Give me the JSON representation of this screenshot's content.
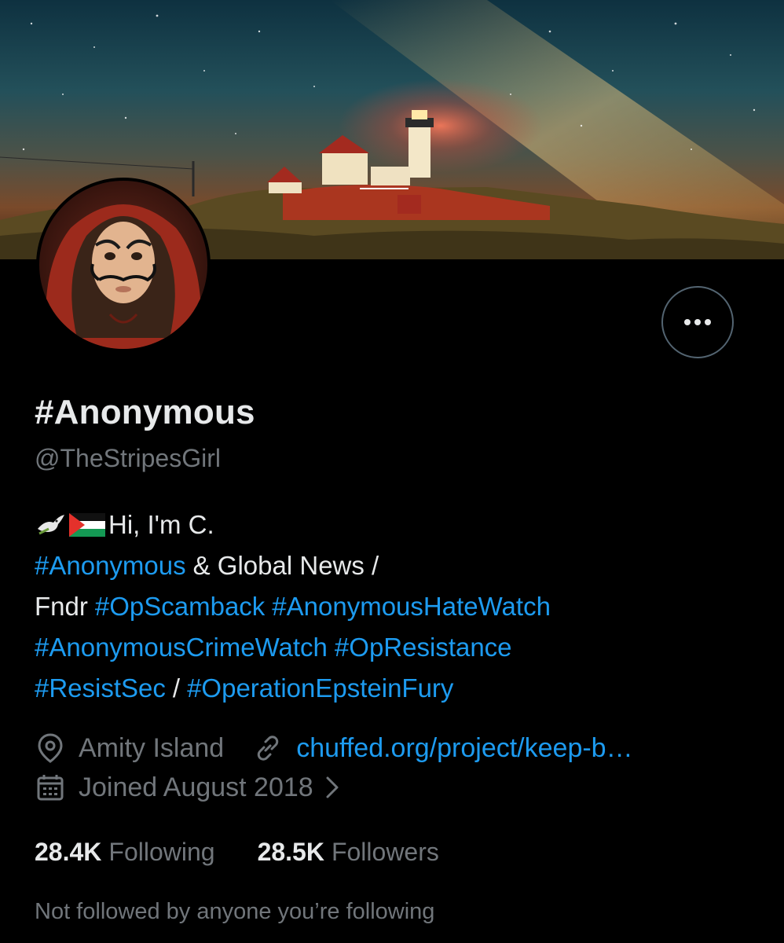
{
  "profile": {
    "display_name": "#Anonymous",
    "handle": "@TheStripesGirl",
    "more_button_icon": "more-horizontal-icon"
  },
  "bio": {
    "line1_text": "Hi, I'm C.",
    "line1_emojis": [
      "dove-emoji",
      "palestine-flag-emoji"
    ],
    "line2_tag": "#Anonymous",
    "line2_text": "& Global News /",
    "line3_text": "Fndr",
    "line3_tag1": "#OpScamback",
    "line3_tag2": "#AnonymousHateWatch",
    "line4_tag1": "#AnonymousCrimeWatch",
    "line4_tag2": "#OpResistance",
    "line5_tag1": "#ResistSec",
    "line5_sep": "/",
    "line5_tag2": "#OperationEpsteinFury"
  },
  "meta": {
    "location": "Amity Island",
    "location_icon": "location-pin-icon",
    "link": "chuffed.org/project/keep-b…",
    "link_icon": "link-icon",
    "joined": "Joined August 2018",
    "joined_icon": "calendar-icon"
  },
  "stats": {
    "following_count": "28.4K",
    "following_label": "Following",
    "followers_count": "28.5K",
    "followers_label": "Followers"
  },
  "followed_by": "Not followed by anyone you’re following",
  "colors": {
    "background": "#000000",
    "primary_text": "#e7e9ea",
    "secondary_text": "#71767b",
    "link": "#1d9bf0",
    "border": "#536471"
  }
}
